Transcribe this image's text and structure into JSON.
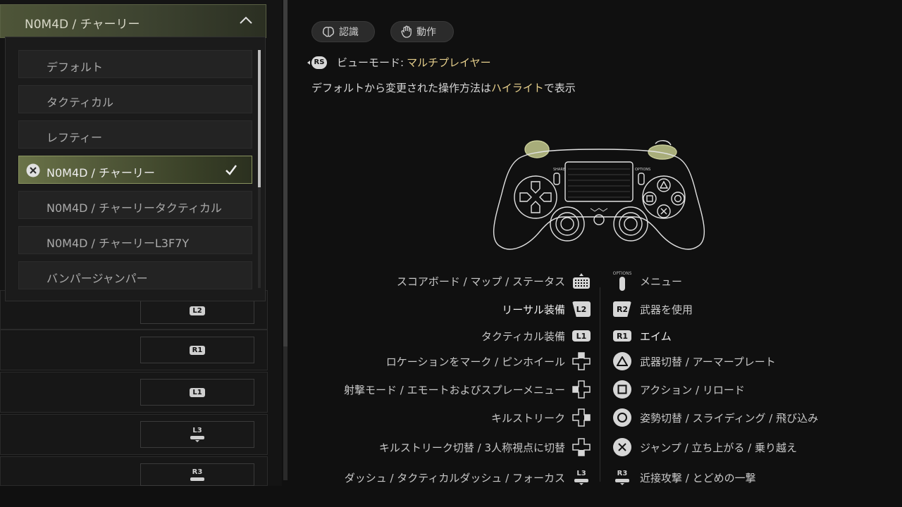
{
  "left_panel": {
    "dropdown": {
      "selected_label": "N0M4D / チャーリー",
      "options": [
        {
          "label": "デフォルト"
        },
        {
          "label": "タクティカル"
        },
        {
          "label": "レフティー"
        },
        {
          "label": "N0M4D / チャーリー",
          "selected": true
        },
        {
          "label": "N0M4D / チャーリータクティカル"
        },
        {
          "label": "N0M4D / チャーリーL3F7Y"
        },
        {
          "label": "バンパージャンパー"
        }
      ]
    },
    "background_rows": [
      {
        "button": "L2"
      },
      {
        "button": "R1"
      },
      {
        "button": "L1"
      },
      {
        "button": "L3"
      },
      {
        "button": "R3"
      }
    ]
  },
  "right_panel": {
    "tabs": [
      {
        "label": "認識",
        "icon": "brain-icon"
      },
      {
        "label": "動作",
        "icon": "hand-icon"
      }
    ],
    "view_mode": {
      "stick": "RS",
      "label": "ビューモード:",
      "value": "マルチプレイヤー"
    },
    "hint": {
      "before": "デフォルトから変更された操作方法は",
      "highlight": "ハイライト",
      "after": "で表示"
    },
    "controller_labels": {
      "share": "SHARE",
      "options": "OPTIONS"
    },
    "mappings_left": [
      {
        "label": "スコアボード / マップ / ステータス",
        "button": "touchpad",
        "highlighted": false
      },
      {
        "label": "リーサル装備",
        "button": "L2",
        "highlighted": true
      },
      {
        "label": "タクティカル装備",
        "button": "L1",
        "highlighted": false
      },
      {
        "label": "ロケーションをマーク / ピンホイール",
        "button": "dpad-up",
        "highlighted": false
      },
      {
        "label": "射撃モード / エモートおよびスプレーメニュー",
        "button": "dpad-left",
        "highlighted": false
      },
      {
        "label": "キルストリーク",
        "button": "dpad-right",
        "highlighted": false
      },
      {
        "label": "キルストリーク切替 / 3人称視点に切替",
        "button": "dpad-down",
        "highlighted": false
      },
      {
        "label": "ダッシュ / タクティカルダッシュ / フォーカス",
        "button": "L3",
        "highlighted": false
      }
    ],
    "mappings_right": [
      {
        "label": "メニュー",
        "button": "OPTIONS",
        "highlighted": false
      },
      {
        "label": "武器を使用",
        "button": "R2",
        "highlighted": false
      },
      {
        "label": "エイム",
        "button": "R1",
        "highlighted": true
      },
      {
        "label": "武器切替 / アーマープレート",
        "button": "triangle",
        "highlighted": false
      },
      {
        "label": "アクション / リロード",
        "button": "square",
        "highlighted": false
      },
      {
        "label": "姿勢切替 / スライディング / 飛び込み",
        "button": "circle",
        "highlighted": false
      },
      {
        "label": "ジャンプ / 立ち上がる / 乗り越え",
        "button": "cross",
        "highlighted": false
      },
      {
        "label": "近接攻撃 / とどめの一撃",
        "button": "R3",
        "highlighted": false
      }
    ],
    "colors": {
      "highlight": "#e6cf8c",
      "selected_gradient": "#6a7348"
    }
  }
}
